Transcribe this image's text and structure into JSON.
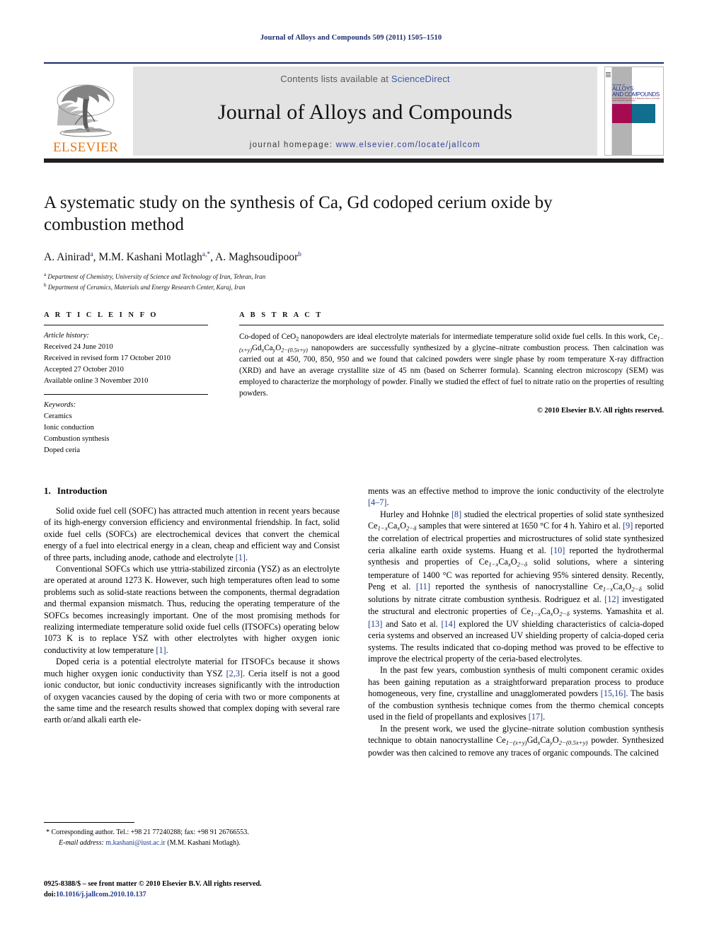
{
  "running_head": "Journal of Alloys and Compounds 509 (2011) 1505–1510",
  "masthead": {
    "contents_prefix": "Contents lists available at ",
    "sciencedirect": "ScienceDirect",
    "journal_name": "Journal of Alloys and Compounds",
    "homepage_prefix": "journal homepage: ",
    "homepage_url": "www.elsevier.com/locate/jallcom",
    "publisher": "ELSEVIER",
    "publisher_color": "#e77817",
    "link_color": "#2f3f96",
    "rule_color": "#1a2a6c",
    "cover": {
      "line1": "Journal of",
      "line2": "ALLOYS",
      "line3": "AND COMPOUNDS",
      "sub": "An Interdisciplinary Journal of Materials Science and Solid-state Chemistry and Physics",
      "magenta": "#a60b52",
      "teal": "#116e8e",
      "grey": "#b3b3b3"
    }
  },
  "article": {
    "title": "A systematic study on the synthesis of Ca, Gd codoped cerium oxide by combustion method",
    "authors_plain": "A. Ainirad a, M.M. Kashani Motlagh a,*, A. Maghsoudipoor b",
    "authors": [
      {
        "name": "A. Ainirad",
        "sup": "a"
      },
      {
        "name": "M.M. Kashani Motlagh",
        "sup": "a,*"
      },
      {
        "name": "A. Maghsoudipoor",
        "sup": "b"
      }
    ],
    "affiliations": [
      {
        "mark": "a",
        "text": "Department of Chemistry, University of Science and Technology of Iran, Tehran, Iran"
      },
      {
        "mark": "b",
        "text": "Department of Ceramics, Materials and Energy Research Center, Karaj, Iran"
      }
    ]
  },
  "article_info": {
    "heading": "A R T I C L E    I N F O",
    "history_label": "Article history:",
    "history": [
      "Received 24 June 2010",
      "Received in revised form 17 October 2010",
      "Accepted 27 October 2010",
      "Available online 3 November 2010"
    ],
    "keywords_label": "Keywords:",
    "keywords": [
      "Ceramics",
      "Ionic conduction",
      "Combustion synthesis",
      "Doped ceria"
    ]
  },
  "abstract": {
    "heading": "A B S T R A C T",
    "text_part1": "Co-doped of CeO",
    "text_part2": " nanopowders are ideal electrolyte materials for intermediate temperature solid oxide fuel cells. In this work, Ce",
    "formula_sub1": "1−(x+y)",
    "formula_gd": "Gd",
    "formula_subx": "x",
    "formula_ca": "Ca",
    "formula_suby": "y",
    "formula_o": "O",
    "formula_sub2": "2−(0.5x+y)",
    "text_part3": " nanopowders are successfully synthesized by a glycine–nitrate combustion process. Then calcination was carried out at 450, 700, 850, 950 and we found that calcined powders were single phase by room temperature X-ray diffraction (XRD) and have an average crystallite size of 45 nm (based on Scherrer formula). Scanning electron microscopy (SEM) was employed to characterize the morphology of powder. Finally we studied the effect of fuel to nitrate ratio on the properties of resulting powders.",
    "copyright": "© 2010 Elsevier B.V. All rights reserved."
  },
  "body": {
    "section_number": "1.",
    "section_title": "Introduction",
    "left_paragraphs": [
      "Solid oxide fuel cell (SOFC) has attracted much attention in recent years because of its high-energy conversion efficiency and environmental friendship. In fact, solid oxide fuel cells (SOFCs) are electrochemical devices that convert the chemical energy of a fuel into electrical energy in a clean, cheap and efficient way and Consist of three parts, including anode, cathode and electrolyte [1].",
      "Conventional SOFCs which use yttria-stabilized zirconia (YSZ) as an electrolyte are operated at around 1273 K. However, such high temperatures often lead to some problems such as solid-state reactions between the components, thermal degradation and thermal expansion mismatch. Thus, reducing the operating temperature of the SOFCs becomes increasingly important. One of the most promising methods for realizing intermediate temperature solid oxide fuel cells (ITSOFCs) operating below 1073 K is to replace YSZ with other electrolytes with higher oxygen ionic conductivity at low temperature [1].",
      "Doped ceria is a potential electrolyte material for ITSOFCs because it shows much higher oxygen ionic conductivity than YSZ [2,3]. Ceria itself is not a good ionic conductor, but ionic conductivity increases significantly with the introduction of oxygen vacancies caused by the doping of ceria with two or more components at the same time and the research results showed that complex doping with several rare earth or/and alkali earth ele-"
    ],
    "right_paragraphs": [
      "ments was an effective method to improve the ionic conductivity of the electrolyte [4–7].",
      "Hurley and Hohnke [8] studied the electrical properties of solid state synthesized Ce1−xCaxO2−δ samples that were sintered at 1650 °C for 4 h. Yahiro et al. [9] reported the correlation of electrical properties and microstructures of solid state synthesized ceria alkaline earth oxide systems. Huang et al. [10] reported the hydrothermal synthesis and properties of Ce1−xCaxO2−δ solid solutions, where a sintering temperature of 1400 °C was reported for achieving 95% sintered density. Recently, Peng et al. [11] reported the synthesis of nanocrystalline Ce1−xCaxO2−δ solid solutions by nitrate citrate combustion synthesis. Rodriguez et al. [12] investigated the structural and electronic properties of Ce1−xCaxO2−δ systems. Yamashita et al. [13] and Sato et al. [14] explored the UV shielding characteristics of calcia-doped ceria systems and observed an increased UV shielding property of calcia-doped ceria systems. The results indicated that co-doping method was proved to be effective to improve the electrical property of the ceria-based electrolytes.",
      "In the past few years, combustion synthesis of multi component ceramic oxides has been gaining reputation as a straightforward preparation process to produce homogeneous, very fine, crystalline and unagglomerated powders [15,16]. The basis of the combustion synthesis technique comes from the thermo chemical concepts used in the field of propellants and explosives [17].",
      "In the present work, we used the glycine–nitrate solution combustion synthesis technique to obtain nanocrystalline Ce1−(x+y)GdxCayO2−(0.5x+y) powder. Synthesized powder was then calcined to remove any traces of organic compounds. The calcined"
    ]
  },
  "footnotes": {
    "corresponding": "* Corresponding author. Tel.: +98 21 77240288; fax: +98 91 26766553.",
    "email_label": "E-mail address:",
    "email_address": "m.kashani@iust.ac.ir",
    "email_owner": "(M.M. Kashani Motlagh)."
  },
  "imprint": {
    "line1": "0925-8388/$ – see front matter © 2010 Elsevier B.V. All rights reserved.",
    "doi_label": "doi:",
    "doi_value": "10.1016/j.jallcom.2010.10.137"
  }
}
